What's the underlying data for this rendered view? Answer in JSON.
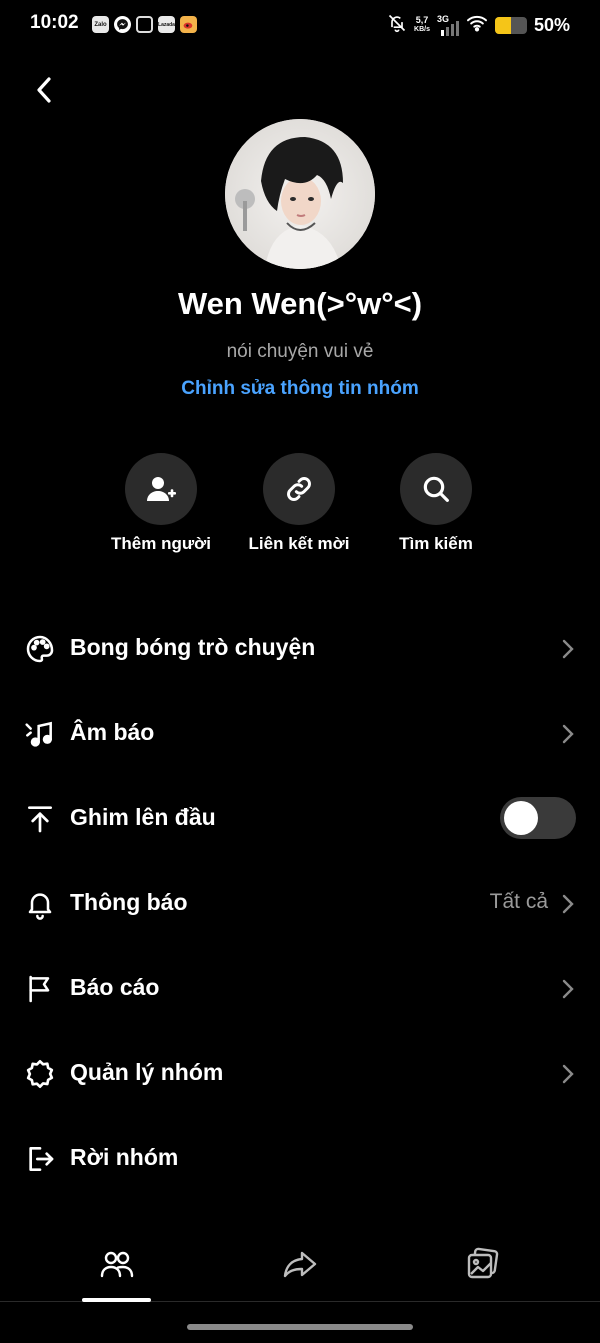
{
  "status_bar": {
    "time": "10:02",
    "app_icons": [
      {
        "name": "zalo-icon",
        "text": "Zalo"
      },
      {
        "name": "messenger-icon",
        "text": ""
      },
      {
        "name": "square-app-icon",
        "text": ""
      },
      {
        "name": "lazada-icon",
        "text": "Lazada"
      },
      {
        "name": "weibo-icon",
        "text": ""
      }
    ],
    "net_speed_value": "5,7",
    "net_speed_unit": "KB/s",
    "network_type": "3G",
    "battery_level": 0.5,
    "battery_percent": "50%"
  },
  "header": {
    "group_name": "Wen Wen(>°w°<)",
    "description": "nói chuyện vui vẻ",
    "edit_link": "Chỉnh sửa thông tin nhóm"
  },
  "actions": [
    {
      "label": "Thêm người",
      "icon": "add-person-icon"
    },
    {
      "label": "Liên kết mời",
      "icon": "link-icon"
    },
    {
      "label": "Tìm kiếm",
      "icon": "search-icon"
    }
  ],
  "settings": {
    "chat_bubbles": {
      "label": "Bong bóng trò chuyện",
      "icon": "palette-icon"
    },
    "sound": {
      "label": "Âm báo",
      "icon": "music-note-icon"
    },
    "pin": {
      "label": "Ghim lên đầu",
      "icon": "pin-to-top-icon",
      "toggle_on": false
    },
    "notifications": {
      "label": "Thông báo",
      "icon": "bell-icon",
      "value": "Tất cả"
    },
    "report": {
      "label": "Báo cáo",
      "icon": "flag-icon"
    },
    "manage_group": {
      "label": "Quản lý nhóm",
      "icon": "gear-icon"
    },
    "leave_group": {
      "label": "Rời nhóm",
      "icon": "exit-icon"
    }
  },
  "tabs": [
    {
      "icon": "members-icon",
      "selected": true
    },
    {
      "icon": "share-icon",
      "selected": false
    },
    {
      "icon": "media-icon",
      "selected": false
    }
  ],
  "colors": {
    "background": "#000000",
    "accent_link": "#4aa3ff",
    "action_circle": "#2b2b2b",
    "battery": "#f5c518"
  }
}
